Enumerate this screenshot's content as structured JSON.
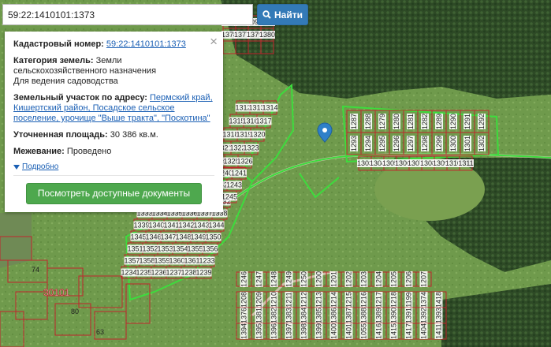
{
  "search": {
    "value": "59:22:1410101:1373",
    "button_label": "Найти"
  },
  "info": {
    "cadastral_label": "Кадастровый номер:",
    "cadastral_value": "59:22:1410101:1373",
    "category_label": "Категория земель:",
    "category_value": "Земли сельскохозяйственного назначения",
    "use_value": "Для ведения садоводства",
    "address_label": "Земельный участок по адресу:",
    "address_value": "Пермский край, Кишертский район, Посадское сельское поселение, урочище \"Выше тракта\", \"Поскотина\"",
    "area_label": "Уточненная площадь:",
    "area_value": "30 386 кв.м.",
    "boundary_label": "Межевание:",
    "boundary_value": "Проведено",
    "more_label": "Подробно",
    "docs_button": "Посмотреть доступные документы",
    "close_glyph": "×"
  },
  "map": {
    "colors": {
      "parcel": "#c0272d",
      "highlight": "#3ddc3d",
      "marker": "#2f80c9"
    },
    "block_label": "30101",
    "parcel_labels": [
      "1287",
      "1288",
      "1279",
      "1280",
      "1281",
      "1282",
      "1289",
      "1290",
      "1291",
      "1292",
      "1293",
      "1294",
      "1295",
      "1296",
      "1297",
      "1298",
      "1299",
      "1300",
      "1301",
      "1302",
      "1303",
      "1304",
      "1305",
      "1306",
      "1307",
      "1308",
      "1309",
      "1310",
      "1311",
      "1312",
      "1313",
      "1314",
      "1315",
      "1316",
      "1317",
      "1318",
      "1319",
      "1320",
      "1321",
      "1322",
      "1323",
      "1324",
      "1325",
      "1326",
      "1327",
      "1328",
      "1329",
      "1330",
      "1331",
      "1332",
      "1333",
      "1334",
      "1335",
      "1336",
      "1337",
      "1338",
      "1339",
      "1340",
      "1341",
      "1342",
      "1343",
      "1344",
      "1345",
      "1346",
      "1347",
      "1348",
      "1349",
      "1350",
      "1351",
      "1352",
      "1353",
      "1354",
      "1355",
      "1356",
      "1357",
      "1358",
      "1359",
      "1360",
      "1361",
      "1233",
      "1234",
      "1235",
      "1236",
      "1237",
      "1238",
      "1239",
      "1240",
      "1241",
      "1242",
      "1243",
      "1244",
      "1245",
      "1246",
      "1247",
      "1248",
      "1249",
      "1250",
      "1200",
      "1201",
      "1202",
      "1203",
      "1204",
      "1205",
      "1206",
      "1207",
      "1208",
      "1209",
      "1210",
      "1211",
      "1212",
      "1213",
      "1214",
      "1215",
      "1216",
      "1217",
      "1218",
      "1199",
      "1374",
      "1418",
      "1376",
      "1381",
      "1382",
      "1383",
      "1384",
      "1385",
      "1386",
      "1387",
      "1388",
      "1389",
      "1390",
      "1391",
      "1392",
      "1393",
      "1394",
      "1395",
      "1396",
      "1397",
      "1398",
      "1399",
      "1400",
      "1401",
      "1055",
      "1416",
      "1415",
      "1417",
      "1404",
      "1411",
      "1095",
      "1096",
      "1097",
      "1098",
      "1378",
      "1377",
      "1379",
      "1380"
    ],
    "small_labels": [
      "74",
      "80",
      "63"
    ]
  }
}
